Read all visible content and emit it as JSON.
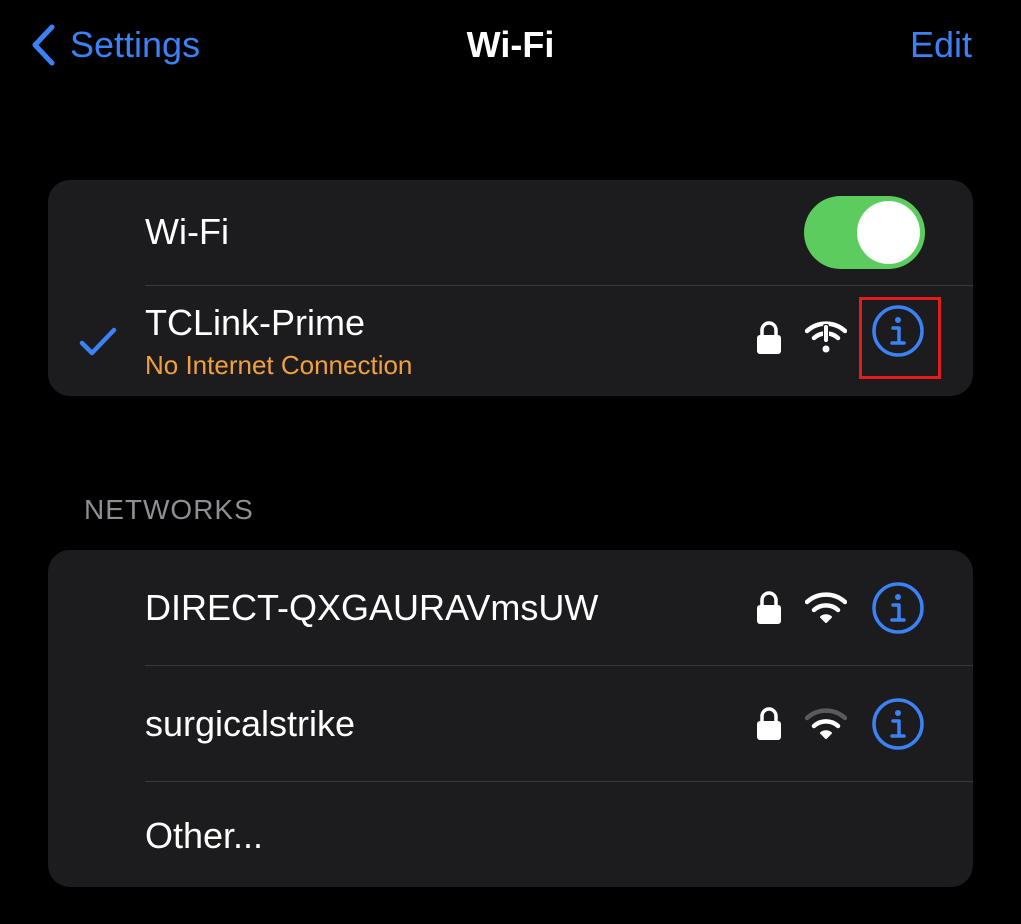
{
  "navbar": {
    "back_label": "Settings",
    "title": "Wi-Fi",
    "edit_label": "Edit"
  },
  "wifi_toggle": {
    "label": "Wi-Fi",
    "state": "on"
  },
  "current_network": {
    "name": "TCLink-Prime",
    "status": "No Internet Connection",
    "secured": true,
    "connected": true
  },
  "networks_section": {
    "header": "NETWORKS",
    "items": [
      {
        "name": "DIRECT-QXGAURAVmsUW",
        "secured": true
      },
      {
        "name": "surgicalstrike",
        "secured": true
      }
    ],
    "other_label": "Other..."
  },
  "colors": {
    "accent": "#3b82f6",
    "toggle_on": "#5ccc5e",
    "warning": "#f2a03d",
    "highlight": "#e11d1d",
    "cell_bg": "#1c1c1e",
    "secondary_text": "#8e8e93"
  },
  "icons": {
    "back": "chevron-left-icon",
    "check": "checkmark-icon",
    "lock": "lock-icon",
    "wifi": "wifi-icon",
    "wifi_no_internet": "wifi-exclamation-icon",
    "info": "info-circle-icon"
  }
}
